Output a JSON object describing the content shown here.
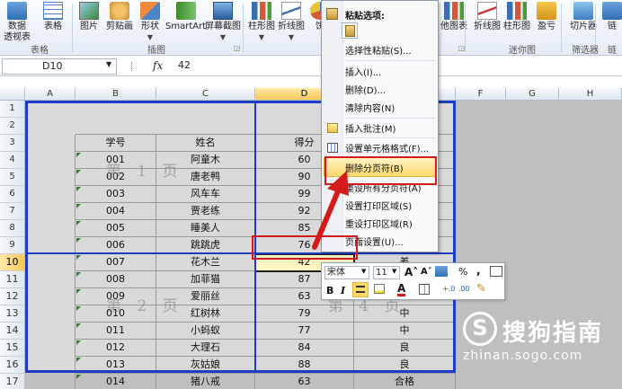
{
  "ribbon": {
    "buttons": [
      {
        "id": "pivot",
        "label": "数据",
        "label2": "透视表",
        "icon": "pivot-table-icon"
      },
      {
        "id": "table",
        "label": "表格",
        "label2": "",
        "icon": "table-icon"
      },
      {
        "id": "picture",
        "label": "图片",
        "label2": "",
        "icon": "picture-icon"
      },
      {
        "id": "clipart",
        "label": "剪贴画",
        "label2": "",
        "icon": "clipart-icon"
      },
      {
        "id": "shapes",
        "label": "形状",
        "label2": "",
        "icon": "shapes-icon"
      },
      {
        "id": "smartart",
        "label": "SmartArt",
        "label2": "",
        "icon": "smartart-icon"
      },
      {
        "id": "screenshot",
        "label": "屏幕截图",
        "label2": "",
        "icon": "screenshot-icon"
      },
      {
        "id": "colchart",
        "label": "柱形图",
        "label2": "",
        "icon": "column-chart-icon"
      },
      {
        "id": "linechart",
        "label": "折线图",
        "label2": "",
        "icon": "line-chart-icon"
      },
      {
        "id": "piechart",
        "label": "饼",
        "label2": "",
        "icon": "pie-chart-icon"
      },
      {
        "id": "otherchart",
        "label": "他图表",
        "label2": "",
        "icon": "other-chart-icon"
      },
      {
        "id": "sparkline",
        "label": "折线图",
        "label2": "",
        "icon": "sparkline-line-icon"
      },
      {
        "id": "sparkcol",
        "label": "柱形图",
        "label2": "",
        "icon": "sparkline-column-icon"
      },
      {
        "id": "winloss",
        "label": "盈亏",
        "label2": "",
        "icon": "win-loss-icon"
      },
      {
        "id": "slicer",
        "label": "切片器",
        "label2": "",
        "icon": "slicer-icon"
      },
      {
        "id": "link",
        "label": "链",
        "label2": "",
        "icon": "hyperlink-icon"
      }
    ],
    "groups": {
      "tables": "表格",
      "illustrations": "插图",
      "sparklines": "迷你图",
      "filter": "筛选器",
      "links": "链"
    }
  },
  "formula_bar": {
    "name_box": "D10",
    "fx": "fx",
    "value": "42"
  },
  "columns": [
    "A",
    "B",
    "C",
    "D",
    "E",
    "F",
    "G",
    "H"
  ],
  "selected_column": "D",
  "selected_row": "10",
  "rows": [
    "1",
    "2",
    "3",
    "4",
    "5",
    "6",
    "7",
    "8",
    "9",
    "10",
    "11",
    "12",
    "13",
    "14",
    "15",
    "16",
    "17",
    "18"
  ],
  "table": {
    "headers": [
      "学号",
      "姓名",
      "得分"
    ],
    "rows": [
      [
        "001",
        "阿童木",
        "60",
        "及格"
      ],
      [
        "002",
        "唐老鸭",
        "90",
        "优"
      ],
      [
        "003",
        "风车车",
        "99",
        "优"
      ],
      [
        "004",
        "贾老练",
        "92",
        "优"
      ],
      [
        "005",
        "睡美人",
        "85",
        "良"
      ],
      [
        "006",
        "跳跳虎",
        "76",
        "中"
      ],
      [
        "007",
        "花木兰",
        "42",
        "差"
      ],
      [
        "008",
        "加菲猫",
        "87",
        "良"
      ],
      [
        "009",
        "爱丽丝",
        "63",
        "及格"
      ],
      [
        "010",
        "红树林",
        "79",
        "中"
      ],
      [
        "011",
        "小蚂蚁",
        "77",
        "中"
      ],
      [
        "012",
        "大理石",
        "84",
        "良"
      ],
      [
        "013",
        "灰姑娘",
        "88",
        "良"
      ],
      [
        "014",
        "猪八戒",
        "63",
        "合格"
      ]
    ]
  },
  "page_watermarks": {
    "page1": "第 1 页",
    "page2": "第 2 页",
    "page4": "第 4 页"
  },
  "context_menu": {
    "paste_options_title": "粘贴选项:",
    "items": [
      {
        "label": "选择性粘贴(S)...",
        "enabled": true
      },
      {
        "label": "插入(I)...",
        "enabled": true
      },
      {
        "label": "删除(D)...",
        "enabled": true
      },
      {
        "label": "清除内容(N)",
        "enabled": true
      },
      {
        "label": "插入批注(M)",
        "enabled": true
      },
      {
        "label": "设置单元格格式(F)...",
        "enabled": true
      },
      {
        "label": "删除分页符(B)",
        "enabled": true,
        "highlighted": true
      },
      {
        "label": "重设所有分页符(A)",
        "enabled": true
      },
      {
        "label": "设置打印区域(S)",
        "enabled": true
      },
      {
        "label": "重设打印区域(R)",
        "enabled": true
      },
      {
        "label": "页面设置(U)...",
        "enabled": true
      }
    ]
  },
  "mini_toolbar": {
    "font": "宋体",
    "size": "11",
    "percent": "%",
    "comma": ",",
    "bold": "B",
    "italic": "I"
  },
  "watermark": {
    "brand": "搜狗指南",
    "url": "zhinan.sogo.com",
    "logo": "S"
  }
}
